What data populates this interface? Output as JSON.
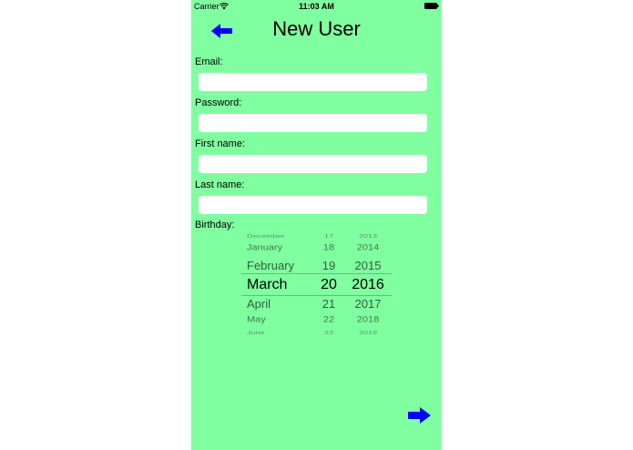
{
  "status_bar": {
    "carrier": "Carrier",
    "time": "11:03 AM"
  },
  "header": {
    "title": "New User",
    "back_icon": "arrow-left-icon"
  },
  "form": {
    "email_label": "Email:",
    "email_value": "",
    "password_label": "Password:",
    "password_value": "",
    "first_name_label": "First name:",
    "first_name_value": "",
    "last_name_label": "Last name:",
    "last_name_value": "",
    "birthday_label": "Birthday:"
  },
  "birthday_picker": {
    "months": [
      "December",
      "January",
      "February",
      "March",
      "April",
      "May",
      "June"
    ],
    "days": [
      "17",
      "18",
      "19",
      "20",
      "21",
      "22",
      "23"
    ],
    "years": [
      "2013",
      "2014",
      "2015",
      "2016",
      "2017",
      "2018",
      "2019"
    ],
    "selected": {
      "month": "March",
      "day": "20",
      "year": "2016"
    }
  },
  "footer": {
    "next_icon": "arrow-right-icon"
  },
  "colors": {
    "background": "#80ffa0",
    "accent": "#0000ff",
    "field": "#ffffff"
  }
}
